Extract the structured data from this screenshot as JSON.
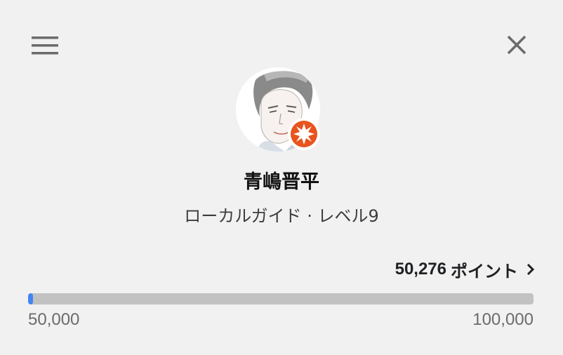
{
  "header": {
    "menu_icon": "hamburger-menu-icon",
    "close_icon": "close-icon"
  },
  "profile": {
    "name": "青嶋晋平",
    "level": "ローカルガイド · レベル9",
    "avatar": "sketched-portrait-avatar",
    "badge_icon": "local-guide-star-badge-icon"
  },
  "points": {
    "value": "50,276",
    "unit": "ポイント",
    "chevron_icon": "chevron-right-icon"
  },
  "progress": {
    "min_label": "50,000",
    "max_label": "100,000",
    "fraction": 0.0055
  },
  "colors": {
    "background": "#f1f1f1",
    "track": "#c2c2c2",
    "fill": "#4285f4",
    "badge": "#e8541d",
    "icon": "#6b6b6b"
  }
}
